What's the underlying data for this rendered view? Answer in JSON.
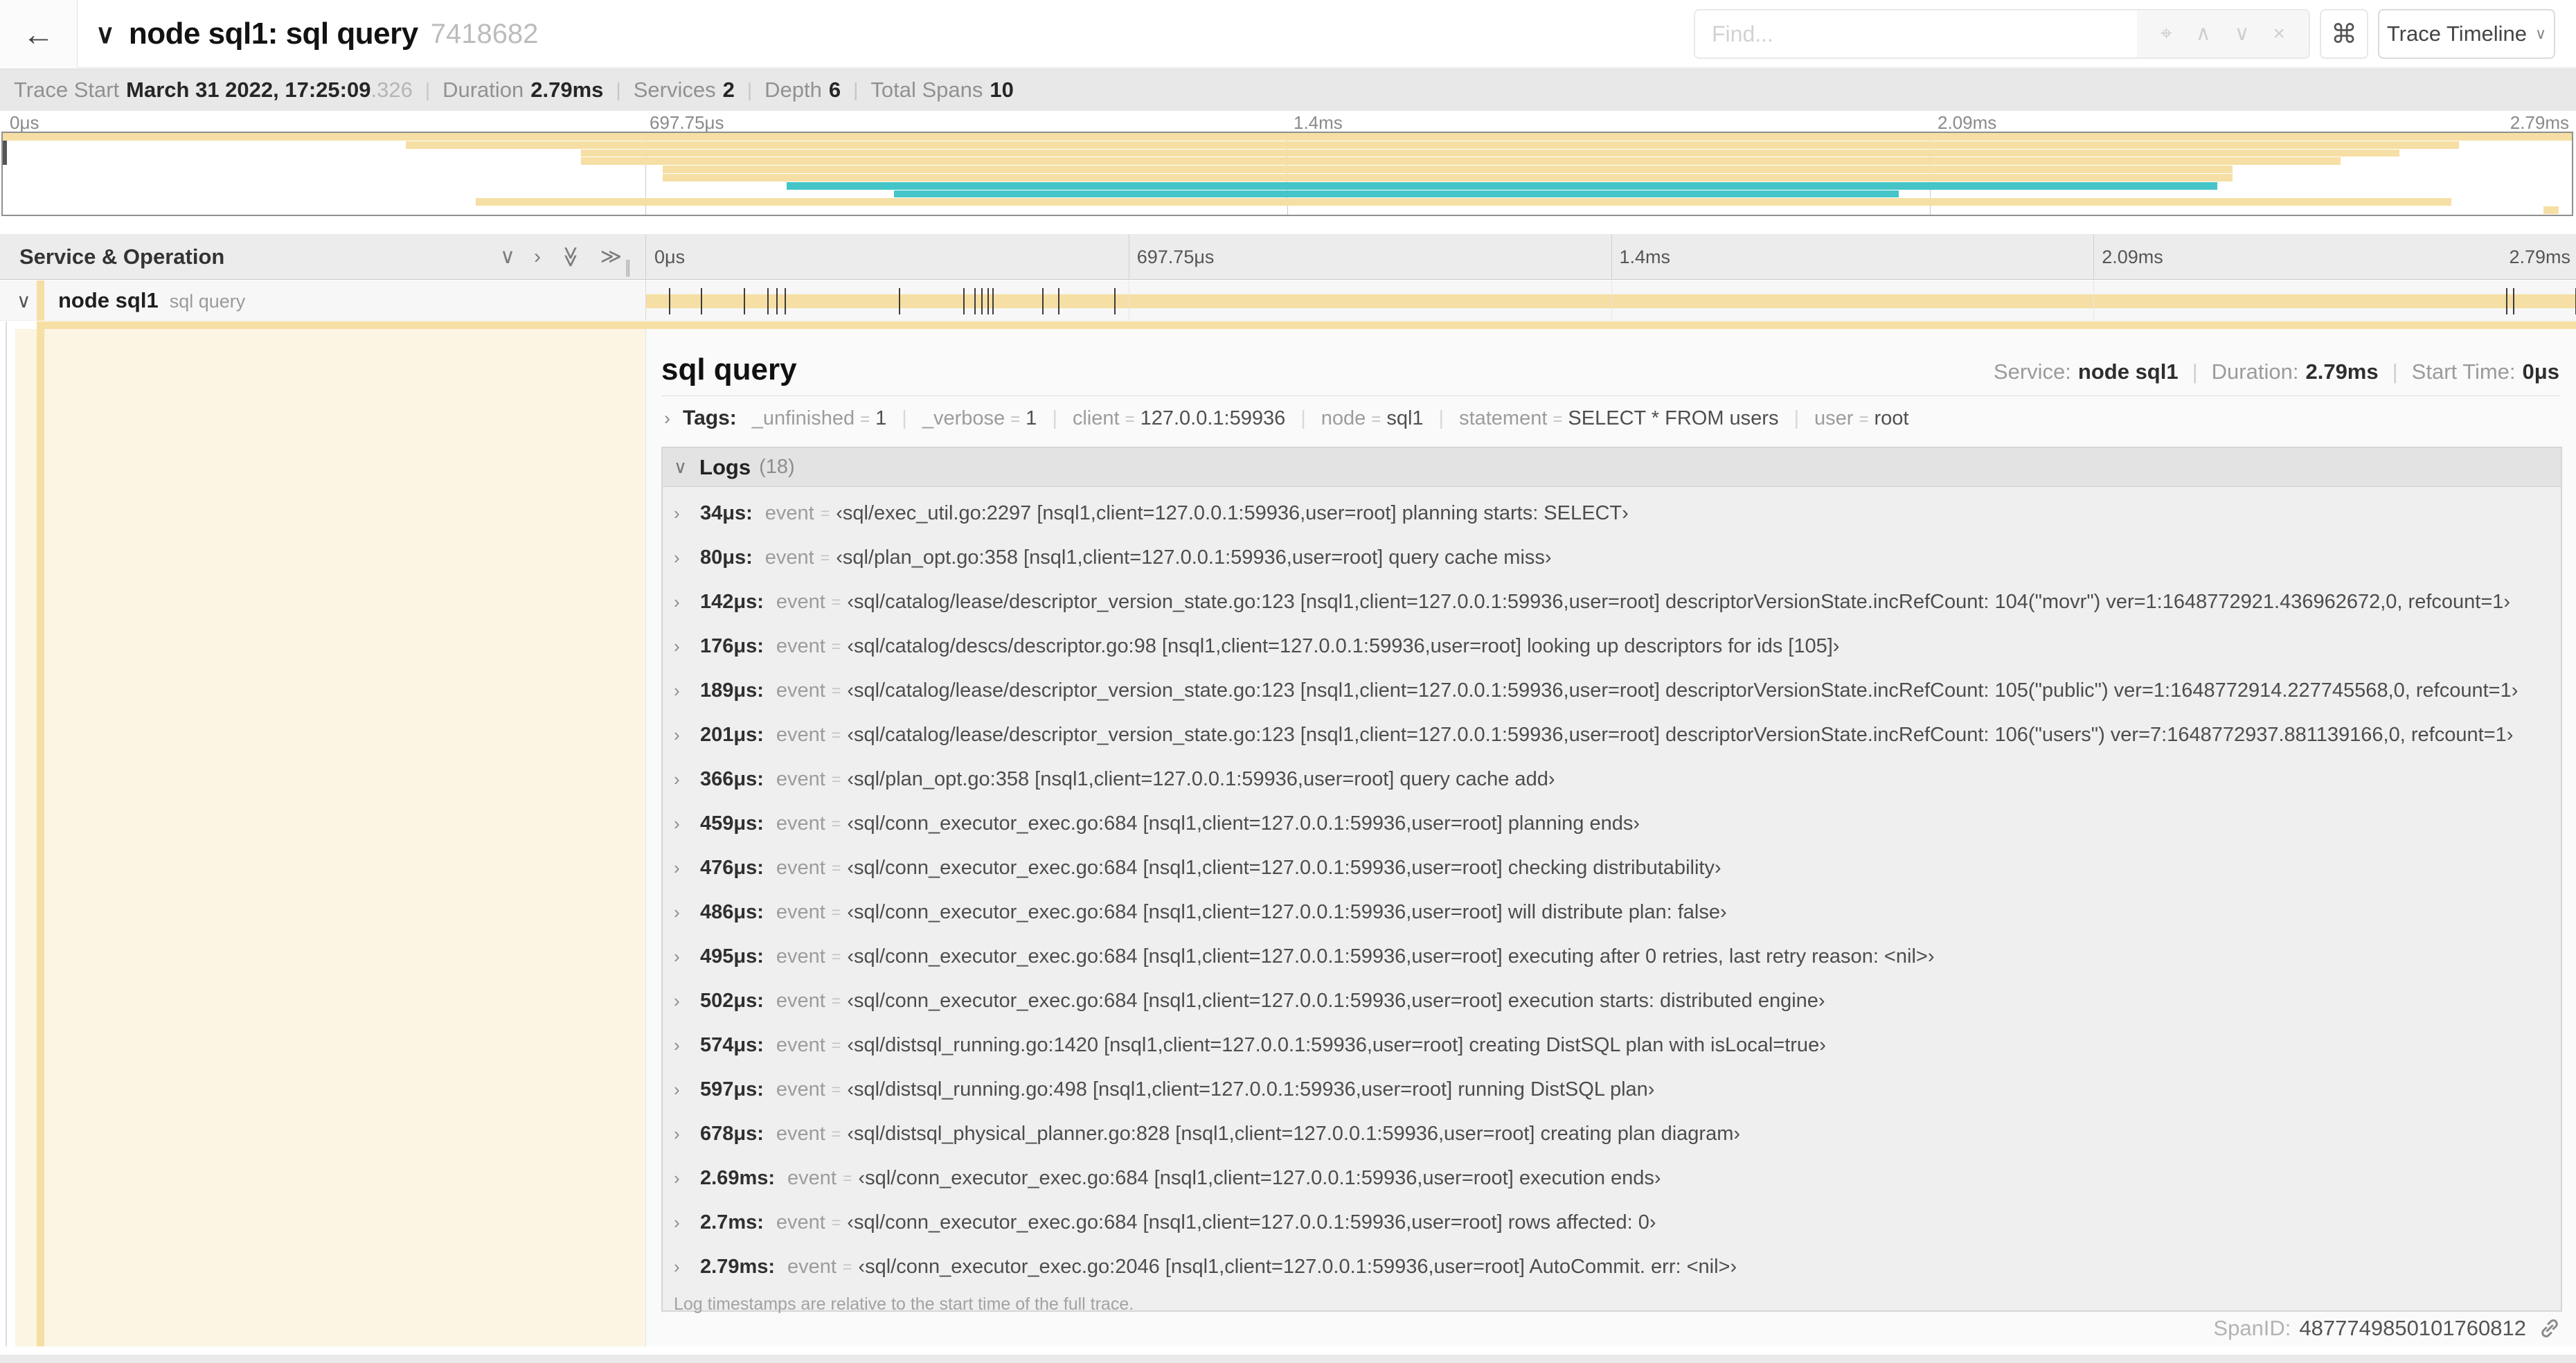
{
  "header": {
    "back_icon": "←",
    "title_chevron": "∨",
    "title": "node sql1: sql query",
    "trace_id": "7418682",
    "find_placeholder": "Find...",
    "find_icons": [
      "⌖",
      "∧",
      "∨",
      "×"
    ],
    "shortcut_icon": "⌘",
    "view_select_label": "Trace Timeline",
    "view_select_caret": "∨"
  },
  "trace_meta": {
    "items": [
      {
        "label": "Trace Start",
        "value": "March 31 2022, 17:25:09",
        "suffix": ".326"
      },
      {
        "label": "Duration",
        "value": "2.79ms"
      },
      {
        "label": "Services",
        "value": "2"
      },
      {
        "label": "Depth",
        "value": "6"
      },
      {
        "label": "Total Spans",
        "value": "10"
      }
    ]
  },
  "timeline": {
    "duration_us": 2790,
    "ruler_ticks": [
      {
        "label": "0μs",
        "pct": 0
      },
      {
        "label": "697.75μs",
        "pct": 25
      },
      {
        "label": "1.4ms",
        "pct": 50
      },
      {
        "label": "2.09ms",
        "pct": 75
      },
      {
        "label": "2.79ms",
        "pct": 100
      }
    ],
    "colors": {
      "tan": "#F6DFA4",
      "teal": "#45C5C7",
      "cream": "#FCF5E4"
    },
    "minimap_spans": [
      {
        "row": 0,
        "start_pct": 0,
        "end_pct": 100,
        "color": "tan"
      },
      {
        "row": 1,
        "start_pct": 15.7,
        "end_pct": 95.6,
        "color": "tan"
      },
      {
        "row": 2,
        "start_pct": 22.5,
        "end_pct": 93.3,
        "color": "tan"
      },
      {
        "row": 3,
        "start_pct": 22.5,
        "end_pct": 91.0,
        "color": "tan"
      },
      {
        "row": 4,
        "start_pct": 25.7,
        "end_pct": 86.8,
        "color": "tan"
      },
      {
        "row": 5,
        "start_pct": 25.7,
        "end_pct": 86.8,
        "color": "tan"
      },
      {
        "row": 6,
        "start_pct": 30.5,
        "end_pct": 86.2,
        "color": "teal"
      },
      {
        "row": 7,
        "start_pct": 34.7,
        "end_pct": 73.8,
        "color": "teal"
      },
      {
        "row": 8,
        "start_pct": 18.4,
        "end_pct": 95.3,
        "color": "tan"
      },
      {
        "row": 9,
        "start_pct": 98.9,
        "end_pct": 99.5,
        "color": "tan"
      }
    ]
  },
  "span_table": {
    "header_label": "Service & Operation",
    "collapse_icons": [
      "chevron-down",
      "chevron-right",
      "double-chevron-down",
      "double-chevron-right"
    ],
    "row": {
      "chevron": "∨",
      "service": "node sql1",
      "operation": "sql query"
    }
  },
  "detail": {
    "title": "sql query",
    "overview": [
      {
        "label": "Service:",
        "value": "node sql1"
      },
      {
        "label": "Duration:",
        "value": "2.79ms"
      },
      {
        "label": "Start Time:",
        "value": "0μs"
      }
    ],
    "tags_chevron": "›",
    "tags_label": "Tags:",
    "tags": [
      {
        "key": "_unfinished",
        "value": "1"
      },
      {
        "key": "_verbose",
        "value": "1"
      },
      {
        "key": "client",
        "value": "127.0.0.1:59936"
      },
      {
        "key": "node",
        "value": "sql1"
      },
      {
        "key": "statement",
        "value": "SELECT * FROM users"
      },
      {
        "key": "user",
        "value": "root"
      }
    ],
    "logs": {
      "chevron": "∨",
      "label": "Logs",
      "count": "(18)",
      "field": "event",
      "note": "Log timestamps are relative to the start time of the full trace.",
      "entries": [
        {
          "time": "34μs",
          "t_us": 34,
          "value": "‹sql/exec_util.go:2297 [nsql1,client=127.0.0.1:59936,user=root] planning starts: SELECT›"
        },
        {
          "time": "80μs",
          "t_us": 80,
          "value": "‹sql/plan_opt.go:358 [nsql1,client=127.0.0.1:59936,user=root] query cache miss›"
        },
        {
          "time": "142μs",
          "t_us": 142,
          "value": "‹sql/catalog/lease/descriptor_version_state.go:123 [nsql1,client=127.0.0.1:59936,user=root] descriptorVersionState.incRefCount: 104(\"movr\") ver=1:1648772921.436962672,0, refcount=1›"
        },
        {
          "time": "176μs",
          "t_us": 176,
          "value": "‹sql/catalog/descs/descriptor.go:98 [nsql1,client=127.0.0.1:59936,user=root] looking up descriptors for ids [105]›"
        },
        {
          "time": "189μs",
          "t_us": 189,
          "value": "‹sql/catalog/lease/descriptor_version_state.go:123 [nsql1,client=127.0.0.1:59936,user=root] descriptorVersionState.incRefCount: 105(\"public\") ver=1:1648772914.227745568,0, refcount=1›"
        },
        {
          "time": "201μs",
          "t_us": 201,
          "value": "‹sql/catalog/lease/descriptor_version_state.go:123 [nsql1,client=127.0.0.1:59936,user=root] descriptorVersionState.incRefCount: 106(\"users\") ver=7:1648772937.881139166,0, refcount=1›"
        },
        {
          "time": "366μs",
          "t_us": 366,
          "value": "‹sql/plan_opt.go:358 [nsql1,client=127.0.0.1:59936,user=root] query cache add›"
        },
        {
          "time": "459μs",
          "t_us": 459,
          "value": "‹sql/conn_executor_exec.go:684 [nsql1,client=127.0.0.1:59936,user=root] planning ends›"
        },
        {
          "time": "476μs",
          "t_us": 476,
          "value": "‹sql/conn_executor_exec.go:684 [nsql1,client=127.0.0.1:59936,user=root] checking distributability›"
        },
        {
          "time": "486μs",
          "t_us": 486,
          "value": "‹sql/conn_executor_exec.go:684 [nsql1,client=127.0.0.1:59936,user=root] will distribute plan: false›"
        },
        {
          "time": "495μs",
          "t_us": 495,
          "value": "‹sql/conn_executor_exec.go:684 [nsql1,client=127.0.0.1:59936,user=root] executing after 0 retries, last retry reason: <nil>›"
        },
        {
          "time": "502μs",
          "t_us": 502,
          "value": "‹sql/conn_executor_exec.go:684 [nsql1,client=127.0.0.1:59936,user=root] execution starts: distributed engine›"
        },
        {
          "time": "574μs",
          "t_us": 574,
          "value": "‹sql/distsql_running.go:1420 [nsql1,client=127.0.0.1:59936,user=root] creating DistSQL plan with isLocal=true›"
        },
        {
          "time": "597μs",
          "t_us": 597,
          "value": "‹sql/distsql_running.go:498 [nsql1,client=127.0.0.1:59936,user=root] running DistSQL plan›"
        },
        {
          "time": "678μs",
          "t_us": 678,
          "value": "‹sql/distsql_physical_planner.go:828 [nsql1,client=127.0.0.1:59936,user=root] creating plan diagram›"
        },
        {
          "time": "2.69ms",
          "t_us": 2690,
          "value": "‹sql/conn_executor_exec.go:684 [nsql1,client=127.0.0.1:59936,user=root] execution ends›"
        },
        {
          "time": "2.7ms",
          "t_us": 2700,
          "value": "‹sql/conn_executor_exec.go:684 [nsql1,client=127.0.0.1:59936,user=root] rows affected: 0›"
        },
        {
          "time": "2.79ms",
          "t_us": 2790,
          "value": "‹sql/conn_executor_exec.go:2046 [nsql1,client=127.0.0.1:59936,user=root] AutoCommit. err: <nil>›"
        }
      ]
    },
    "span_id_label": "SpanID:",
    "span_id": "4877749850101760812"
  }
}
